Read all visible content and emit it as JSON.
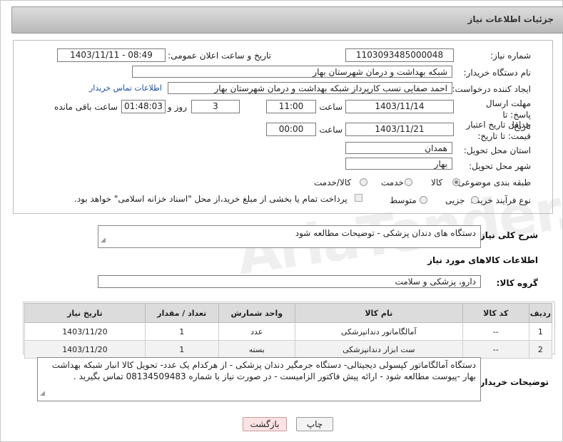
{
  "header": {
    "title": "جزئیات اطلاعات نیاز"
  },
  "fields": {
    "need_number_label": "شماره نیاز:",
    "need_number": "1103093485000048",
    "announce_label": "تاریخ و ساعت اعلان عمومی:",
    "announce_value": "1403/11/11 - 08:49",
    "buyer_org_label": "نام دستگاه خریدار:",
    "buyer_org": "شبکه بهداشت و درمان شهرستان بهار",
    "requester_label": "ایجاد کننده درخواست:",
    "requester": "احمد صفایی نسب کارپرداز شبکه بهداشت و درمان شهرستان بهار",
    "contact_link": "اطلاعات تماس خریدار",
    "deadline_label": "مهلت ارسال پاسخ: تا تاریخ:",
    "deadline_date": "1403/11/14",
    "time_label": "ساعت",
    "deadline_time": "11:00",
    "days_value": "3",
    "days_label": "روز و",
    "remaining_time": "01:48:03",
    "remaining_label": "ساعت باقی مانده",
    "validity_label": "حداقل تاریخ اعتبار قیمت: تا تاریخ:",
    "validity_date": "1403/11/21",
    "validity_time": "00:00",
    "province_label": "استان محل تحویل:",
    "province": "همدان",
    "city_label": "شهر محل تحویل:",
    "city": "بهار",
    "category_label": "طبقه بندی موضوعی:",
    "category_options": [
      "کالا",
      "خدمت",
      "کالا/خدمت"
    ],
    "purchase_type_label": "نوع فرآیند خرید :",
    "purchase_options": [
      "جزیی",
      "متوسط"
    ],
    "purchase_note": "پرداخت تمام یا بخشی از مبلغ خرید،از محل \"اسناد خزانه اسلامی\" خواهد بود."
  },
  "description": {
    "label": "شرح کلی نیاز:",
    "value": "دستگاه های دندان پزشکی - توضیحات مطالعه شود"
  },
  "goods_section": {
    "title": "اطلاعات کالاهای مورد نیاز",
    "group_label": "گروه کالا:",
    "group_value": "دارو، پزشکی و سلامت"
  },
  "table": {
    "headers": [
      "ردیف",
      "کد کالا",
      "نام کالا",
      "واحد شمارش",
      "تعداد / مقدار",
      "تاریخ نیاز"
    ],
    "rows": [
      [
        "1",
        "--",
        "آمالگاماتور دندانپزشکی",
        "عدد",
        "1",
        "1403/11/20"
      ],
      [
        "2",
        "--",
        "ست ابزار دندانپزشکی",
        "بسته",
        "1",
        "1403/11/20"
      ]
    ]
  },
  "buyer_notes": {
    "label": "توضیحات خریدار:",
    "value": "دستگاه آمالگاماتور کپسولی دیجیتالی- دستگاه جرمگیر دندان پزشکی - از هرکدام یک عدد- تحویل کالا انبار شبکه بهداشت بهار -پیوست مطالعه شود - ارائه پیش فاکتور الزامیست - در صورت نیاز با شماره 08134509483 تماس بگیرید ."
  },
  "buttons": {
    "print": "چاپ",
    "back": "بازگشت"
  },
  "watermark": "AriaTender.neT"
}
